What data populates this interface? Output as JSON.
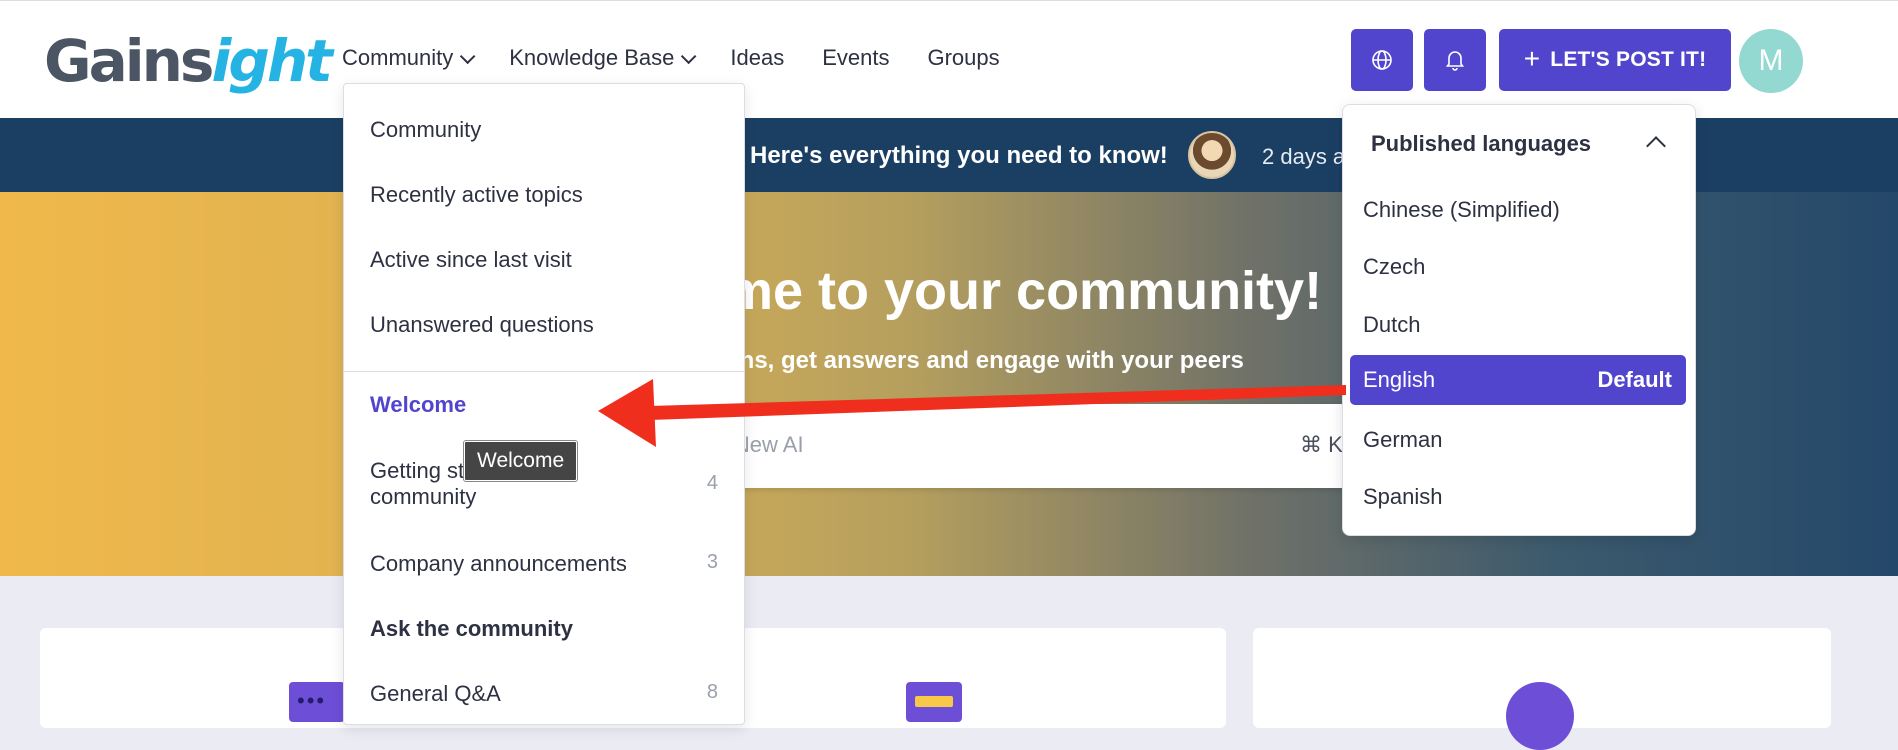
{
  "brand": {
    "logo_part1": "Gains",
    "logo_part2": "ight"
  },
  "nav": {
    "items": [
      {
        "label": "Community",
        "has_dropdown": true
      },
      {
        "label": "Knowledge Base",
        "has_dropdown": true
      },
      {
        "label": "Ideas",
        "has_dropdown": false
      },
      {
        "label": "Events",
        "has_dropdown": false
      },
      {
        "label": "Groups",
        "has_dropdown": false
      }
    ]
  },
  "header_buttons": {
    "globe_icon": "globe-icon",
    "bell_icon": "bell-icon",
    "post_label": "LET'S POST IT!",
    "avatar_initial": "M"
  },
  "announcement": {
    "title": "Here's everything you need to know!",
    "time": "2 days a"
  },
  "hero": {
    "title": "me to your community!",
    "subtitle": "ons, get answers and engage with your peers",
    "search_placeholder": "ll New AI",
    "search_shortcut": "⌘ K"
  },
  "community_menu": {
    "items": [
      {
        "label": "Community"
      },
      {
        "label": "Recently active topics"
      },
      {
        "label": "Active since last visit"
      },
      {
        "label": "Unanswered questions"
      }
    ],
    "categories": [
      {
        "label": "Welcome",
        "count": ""
      },
      {
        "label": "Getting st",
        "label_line2": "community",
        "count": "4"
      },
      {
        "label": "Company announcements",
        "count": "3"
      },
      {
        "label": "Ask the community",
        "count": ""
      },
      {
        "label": "General Q&A",
        "count": "8"
      }
    ],
    "tooltip": "Welcome"
  },
  "languages": {
    "header": "Published languages",
    "items": [
      "Chinese (Simplified)",
      "Czech",
      "Dutch",
      "German",
      "Spanish"
    ],
    "selected": {
      "name": "English",
      "tag": "Default"
    }
  },
  "colors": {
    "accent": "#5145cd",
    "announce_bg": "#1b3f63",
    "arrow": "#f02e1e",
    "page_bg": "#ebebf4"
  }
}
